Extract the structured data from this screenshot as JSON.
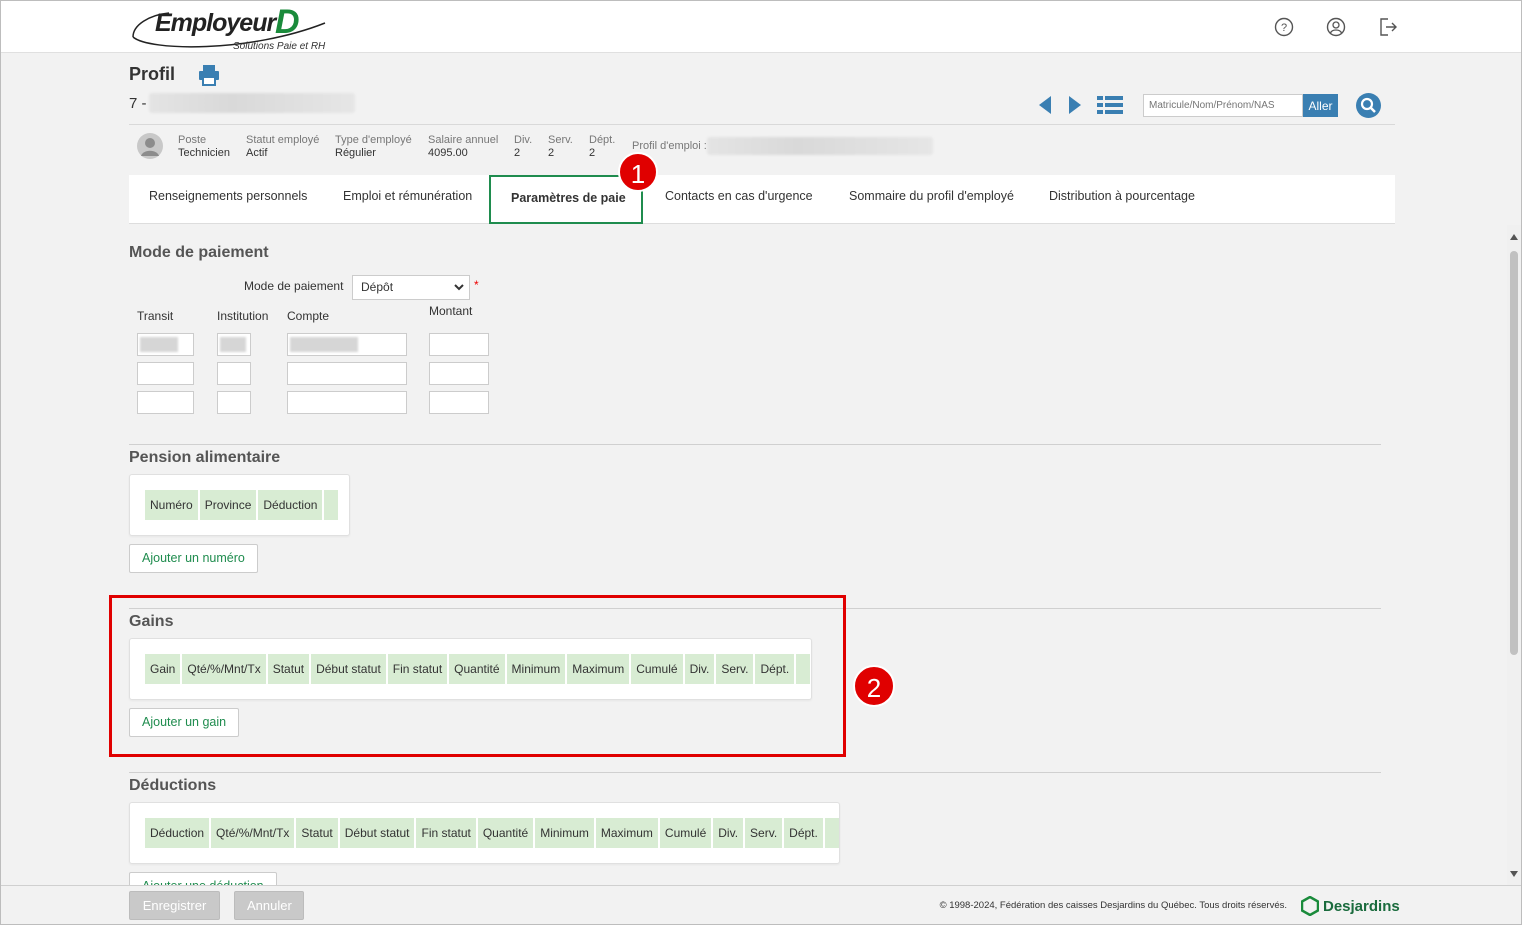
{
  "logo": {
    "word": "Employeur",
    "letter": "D",
    "subtitle": "Solutions Paie et RH"
  },
  "header_icons": [
    "help-icon",
    "user-account-icon",
    "logout-icon"
  ],
  "profile": {
    "title": "Profil",
    "id_prefix": "7 -"
  },
  "search": {
    "placeholder": "Matricule/Nom/Prénom/NAS",
    "go_label": "Aller"
  },
  "employee": {
    "poste_label": "Poste",
    "poste": "Technicien",
    "statut_label": "Statut employé",
    "statut": "Actif",
    "type_label": "Type d'employé",
    "type": "Régulier",
    "salaire_label": "Salaire annuel",
    "salaire": "4095.00",
    "div_label": "Div.",
    "div": "2",
    "serv_label": "Serv.",
    "serv": "2",
    "dept_label": "Dépt.",
    "dept": "2",
    "profil_emploi_label": "Profil d'emploi :"
  },
  "tabs": [
    {
      "label": "Renseignements personnels"
    },
    {
      "label": "Emploi et rémunération"
    },
    {
      "label": "Paramètres de paie",
      "active": true
    },
    {
      "label": "Contacts en cas d'urgence"
    },
    {
      "label": "Sommaire du profil d'employé"
    },
    {
      "label": "Distribution à pourcentage"
    }
  ],
  "annotations": {
    "one": "1",
    "two": "2"
  },
  "mode_paiement": {
    "section_title": "Mode de paiement",
    "field_label": "Mode de paiement",
    "selected": "Dépôt",
    "required_mark": "*",
    "col_transit": "Transit",
    "col_institution": "Institution",
    "col_compte": "Compte",
    "col_montant": "Montant"
  },
  "pension": {
    "section_title": "Pension alimentaire",
    "columns": [
      "Numéro",
      "Province",
      "Déduction"
    ],
    "add_label": "Ajouter un numéro"
  },
  "gains": {
    "section_title": "Gains",
    "columns": [
      "Gain",
      "Qté/%/Mnt/Tx",
      "Statut",
      "Début statut",
      "Fin statut",
      "Quantité",
      "Minimum",
      "Maximum",
      "Cumulé",
      "Div.",
      "Serv.",
      "Dépt."
    ],
    "add_label": "Ajouter un gain"
  },
  "deductions": {
    "section_title": "Déductions",
    "columns": [
      "Déduction",
      "Qté/%/Mnt/Tx",
      "Statut",
      "Début statut",
      "Fin statut",
      "Quantité",
      "Minimum",
      "Maximum",
      "Cumulé",
      "Div.",
      "Serv.",
      "Dépt."
    ],
    "add_label": "Ajouter une déduction"
  },
  "footer": {
    "save_label": "Enregistrer",
    "cancel_label": "Annuler",
    "copyright": "© 1998-2024, Fédération des caisses Desjardins du Québec. Tous droits réservés.",
    "brand": "Desjardins"
  },
  "colors": {
    "accent_green": "#1f8c4e",
    "table_header": "#d8ecd3",
    "annotation_red": "#e00000",
    "nav_blue": "#3a7fb2"
  }
}
